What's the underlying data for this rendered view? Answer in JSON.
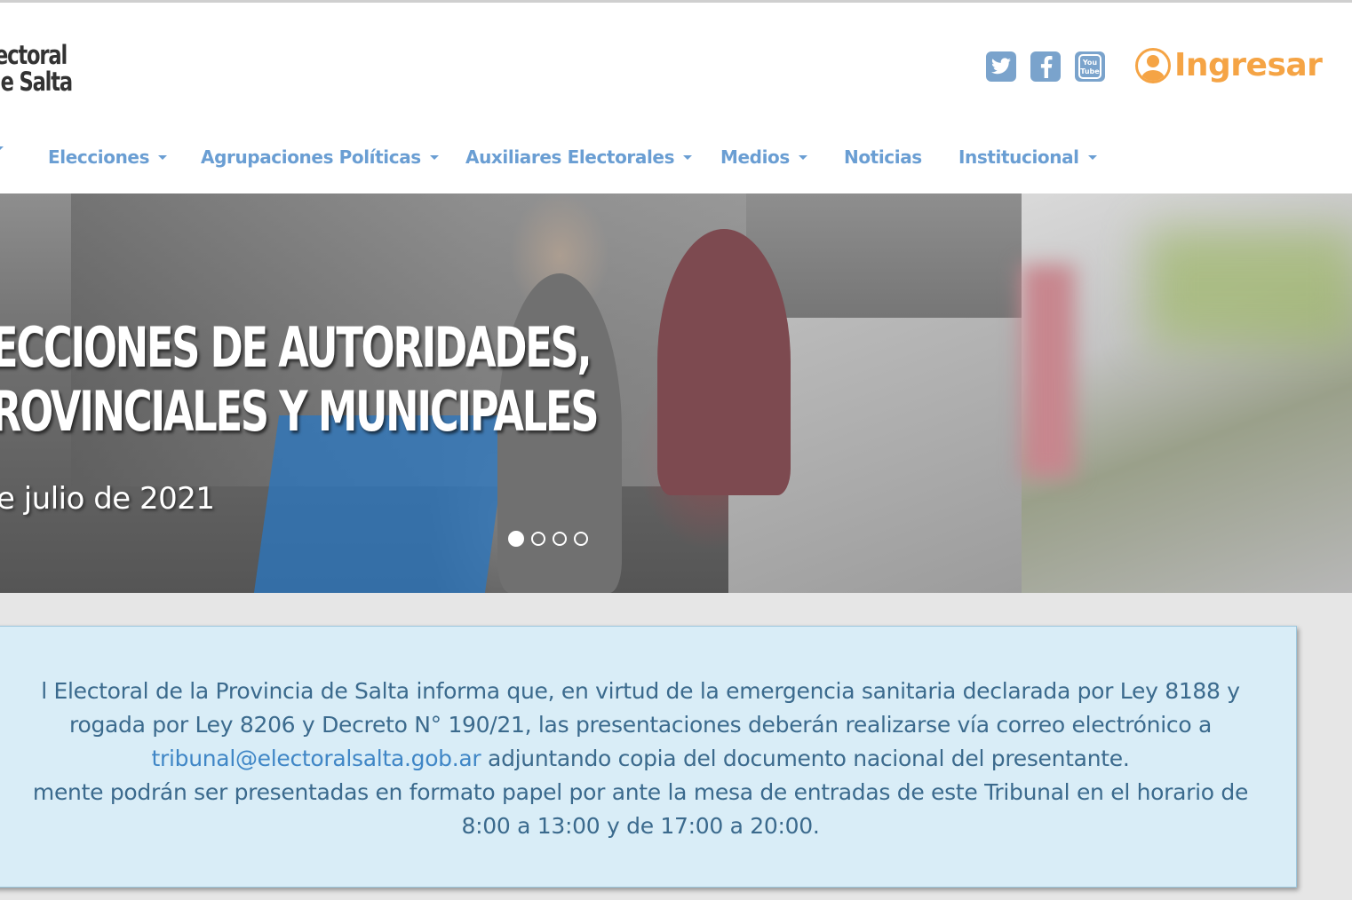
{
  "header": {
    "logo": {
      "line1": "ectoral",
      "line2": "le Salta"
    },
    "social": [
      {
        "name": "twitter-icon"
      },
      {
        "name": "facebook-icon"
      },
      {
        "name": "youtube-icon",
        "text_line1": "You",
        "text_line2": "Tube"
      }
    ],
    "login_label": "Ingresar",
    "colors": {
      "accent": "#f5a445",
      "nav": "#6a9ed3",
      "social": "#7aa3cc"
    }
  },
  "nav": {
    "items": [
      {
        "label": "Elecciones"
      },
      {
        "label": "Agrupaciones Políticas"
      },
      {
        "label": "Auxiliares Electorales"
      },
      {
        "label": "Medios"
      },
      {
        "label": "Noticias"
      },
      {
        "label": "Institucional"
      }
    ]
  },
  "hero": {
    "title_line1": "ECCIONES DE AUTORIDADES,",
    "title_line2": "ROVINCIALES Y MUNICIPALES",
    "date": "e julio de 2021",
    "slides_total": 4,
    "active_slide": 1
  },
  "notice": {
    "line1": "l Electoral de la Provincia de Salta informa que, en virtud de la emergencia sanitaria declarada por Ley 8188 y",
    "line2": "rogada por Ley 8206 y Decreto N° 190/21, las presentaciones deberán realizarse vía correo electrónico a",
    "email": "tribunal@electoralsalta.gob.ar",
    "line3_rest": " adjuntando copia del documento nacional del presentante.",
    "line4": "mente podrán ser presentadas en formato papel por ante la mesa de entradas de este Tribunal en el horario de",
    "line5": "8:00 a 13:00 y de 17:00 a 20:00.",
    "colors": {
      "background": "#d9edf7",
      "text": "#3b6a8d",
      "link": "#3f86c6"
    }
  }
}
